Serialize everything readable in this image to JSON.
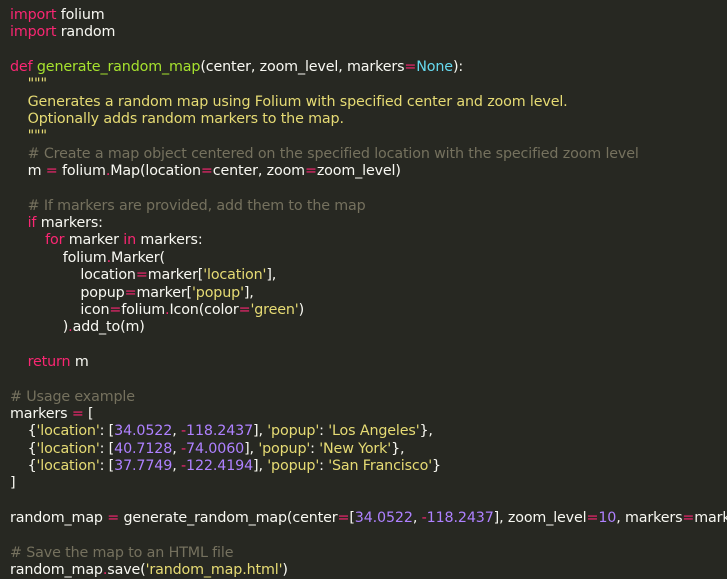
{
  "editor": {
    "language": "python",
    "theme_colors": {
      "background": "#272822",
      "plain": "#f8f8f2",
      "keyword": "#f92672",
      "function": "#a6e22e",
      "string": "#e6db74",
      "comment": "#75715e",
      "number": "#ae81ff"
    },
    "lines": [
      [
        [
          "kw",
          "import"
        ],
        [
          "pl",
          " folium"
        ]
      ],
      [
        [
          "kw",
          "import"
        ],
        [
          "pl",
          " random"
        ]
      ],
      [],
      [
        [
          "kw",
          "def"
        ],
        [
          "pl",
          " "
        ],
        [
          "fn",
          "generate_random_map"
        ],
        [
          "pl",
          "(center, zoom_level, markers"
        ],
        [
          "op",
          "="
        ],
        [
          "prm",
          "None"
        ],
        [
          "pl",
          "):"
        ]
      ],
      [
        [
          "pl",
          "    "
        ],
        [
          "doc",
          "\"\"\""
        ]
      ],
      [
        [
          "pl",
          "    "
        ],
        [
          "doc",
          "Generates a random map using Folium with specified center and zoom level."
        ]
      ],
      [
        [
          "pl",
          "    "
        ],
        [
          "doc",
          "Optionally adds random markers to the map."
        ]
      ],
      [
        [
          "pl",
          "    "
        ],
        [
          "doc",
          "\"\"\""
        ]
      ],
      [
        [
          "pl",
          "    "
        ],
        [
          "cm",
          "# Create a map object centered on the specified location with the specified zoom level"
        ]
      ],
      [
        [
          "pl",
          "    m "
        ],
        [
          "op",
          "="
        ],
        [
          "pl",
          " folium"
        ],
        [
          "op",
          "."
        ],
        [
          "pl",
          "Map(location"
        ],
        [
          "op",
          "="
        ],
        [
          "pl",
          "center, zoom"
        ],
        [
          "op",
          "="
        ],
        [
          "pl",
          "zoom_level)"
        ]
      ],
      [],
      [
        [
          "pl",
          "    "
        ],
        [
          "cm",
          "# If markers are provided, add them to the map"
        ]
      ],
      [
        [
          "pl",
          "    "
        ],
        [
          "kw",
          "if"
        ],
        [
          "pl",
          " markers:"
        ]
      ],
      [
        [
          "pl",
          "        "
        ],
        [
          "kw",
          "for"
        ],
        [
          "pl",
          " marker "
        ],
        [
          "kw",
          "in"
        ],
        [
          "pl",
          " markers:"
        ]
      ],
      [
        [
          "pl",
          "            folium"
        ],
        [
          "op",
          "."
        ],
        [
          "pl",
          "Marker("
        ]
      ],
      [
        [
          "pl",
          "                location"
        ],
        [
          "op",
          "="
        ],
        [
          "pl",
          "marker["
        ],
        [
          "str",
          "'location'"
        ],
        [
          "pl",
          "],"
        ]
      ],
      [
        [
          "pl",
          "                popup"
        ],
        [
          "op",
          "="
        ],
        [
          "pl",
          "marker["
        ],
        [
          "str",
          "'popup'"
        ],
        [
          "pl",
          "],"
        ]
      ],
      [
        [
          "pl",
          "                icon"
        ],
        [
          "op",
          "="
        ],
        [
          "pl",
          "folium"
        ],
        [
          "op",
          "."
        ],
        [
          "pl",
          "Icon(color"
        ],
        [
          "op",
          "="
        ],
        [
          "str",
          "'green'"
        ],
        [
          "pl",
          ")"
        ]
      ],
      [
        [
          "pl",
          "            )"
        ],
        [
          "op",
          "."
        ],
        [
          "pl",
          "add_to(m)"
        ]
      ],
      [],
      [
        [
          "pl",
          "    "
        ],
        [
          "kw",
          "return"
        ],
        [
          "pl",
          " m"
        ]
      ],
      [],
      [
        [
          "cm",
          "# Usage example"
        ]
      ],
      [
        [
          "pl",
          "markers "
        ],
        [
          "op",
          "="
        ],
        [
          "pl",
          " ["
        ]
      ],
      [
        [
          "pl",
          "    {"
        ],
        [
          "str",
          "'location'"
        ],
        [
          "pl",
          ": ["
        ],
        [
          "num",
          "34.0522"
        ],
        [
          "pl",
          ", "
        ],
        [
          "op",
          "-"
        ],
        [
          "num",
          "118.2437"
        ],
        [
          "pl",
          "], "
        ],
        [
          "str",
          "'popup'"
        ],
        [
          "pl",
          ": "
        ],
        [
          "str",
          "'Los Angeles'"
        ],
        [
          "pl",
          "},"
        ]
      ],
      [
        [
          "pl",
          "    {"
        ],
        [
          "str",
          "'location'"
        ],
        [
          "pl",
          ": ["
        ],
        [
          "num",
          "40.7128"
        ],
        [
          "pl",
          ", "
        ],
        [
          "op",
          "-"
        ],
        [
          "num",
          "74.0060"
        ],
        [
          "pl",
          "], "
        ],
        [
          "str",
          "'popup'"
        ],
        [
          "pl",
          ": "
        ],
        [
          "str",
          "'New York'"
        ],
        [
          "pl",
          "},"
        ]
      ],
      [
        [
          "pl",
          "    {"
        ],
        [
          "str",
          "'location'"
        ],
        [
          "pl",
          ": ["
        ],
        [
          "num",
          "37.7749"
        ],
        [
          "pl",
          ", "
        ],
        [
          "op",
          "-"
        ],
        [
          "num",
          "122.4194"
        ],
        [
          "pl",
          "], "
        ],
        [
          "str",
          "'popup'"
        ],
        [
          "pl",
          ": "
        ],
        [
          "str",
          "'San Francisco'"
        ],
        [
          "pl",
          "}"
        ]
      ],
      [
        [
          "pl",
          "]"
        ]
      ],
      [],
      [
        [
          "pl",
          "random_map "
        ],
        [
          "op",
          "="
        ],
        [
          "pl",
          " generate_random_map(center"
        ],
        [
          "op",
          "="
        ],
        [
          "pl",
          "["
        ],
        [
          "num",
          "34.0522"
        ],
        [
          "pl",
          ", "
        ],
        [
          "op",
          "-"
        ],
        [
          "num",
          "118.2437"
        ],
        [
          "pl",
          "], zoom_level"
        ],
        [
          "op",
          "="
        ],
        [
          "num",
          "10"
        ],
        [
          "pl",
          ", markers"
        ],
        [
          "op",
          "="
        ],
        [
          "pl",
          "markers)"
        ]
      ],
      [],
      [
        [
          "cm",
          "# Save the map to an HTML file"
        ]
      ],
      [
        [
          "pl",
          "random_map"
        ],
        [
          "op",
          "."
        ],
        [
          "pl",
          "save("
        ],
        [
          "str",
          "'random_map.html'"
        ],
        [
          "pl",
          ")"
        ]
      ]
    ]
  }
}
